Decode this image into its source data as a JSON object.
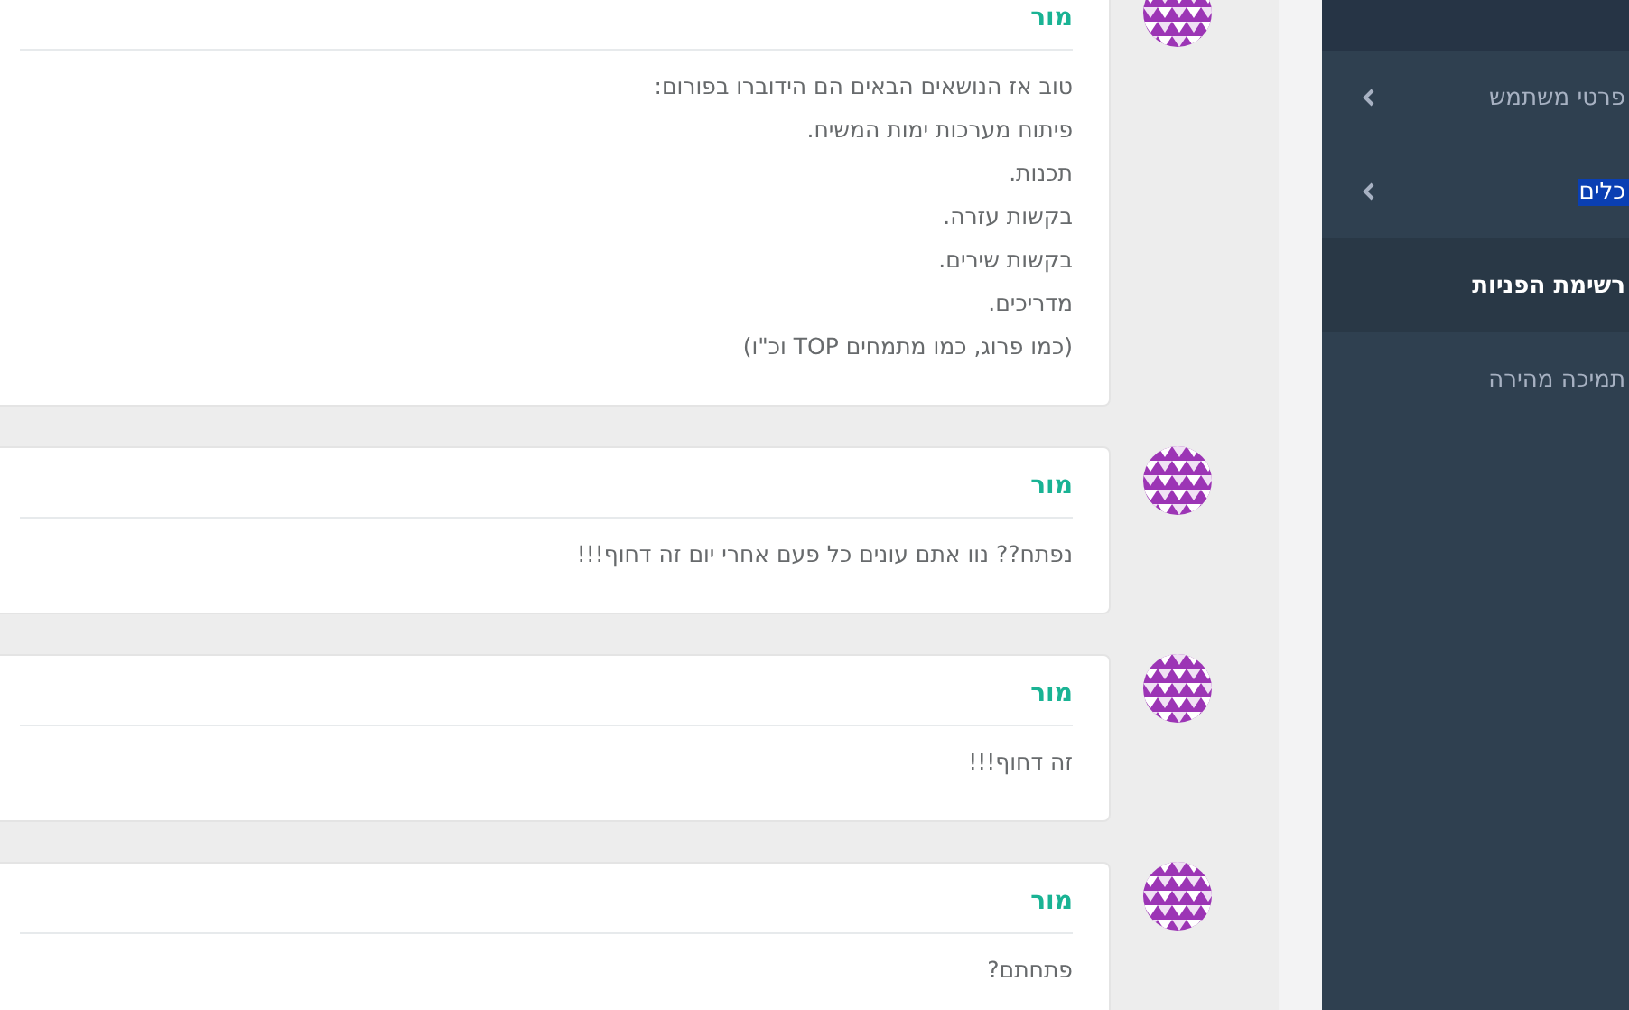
{
  "messages": [
    {
      "author": "מור",
      "lines": [
        "טוב אז הנושאים הבאים הם הידוברו בפורום:",
        "פיתוח מערכות ימות המשיח.",
        "תכנות.",
        "בקשות עזרה.",
        "בקשות שירים.",
        "מדריכים.",
        "(כמו פרוג, כמו מתמחים TOP וכ\"ו)"
      ]
    },
    {
      "author": "מור",
      "lines": [
        "נפתח?? נוו אתם עונים כל פעם אחרי יום זה דחוף!!!"
      ]
    },
    {
      "author": "מור",
      "lines": [
        "זה דחוף!!!"
      ]
    },
    {
      "author": "מור",
      "lines": [
        "פתחתם?"
      ]
    }
  ],
  "sidebar": {
    "items": [
      {
        "label": "פרטי משתמש",
        "expandable": true,
        "selected": false,
        "highlighted": false
      },
      {
        "label": "כלים",
        "expandable": true,
        "selected": false,
        "highlighted": true
      },
      {
        "label": "רשימת הפניות",
        "expandable": false,
        "selected": true,
        "highlighted": false
      },
      {
        "label": "תמיכה מהירה",
        "expandable": false,
        "selected": false,
        "highlighted": false
      }
    ]
  }
}
